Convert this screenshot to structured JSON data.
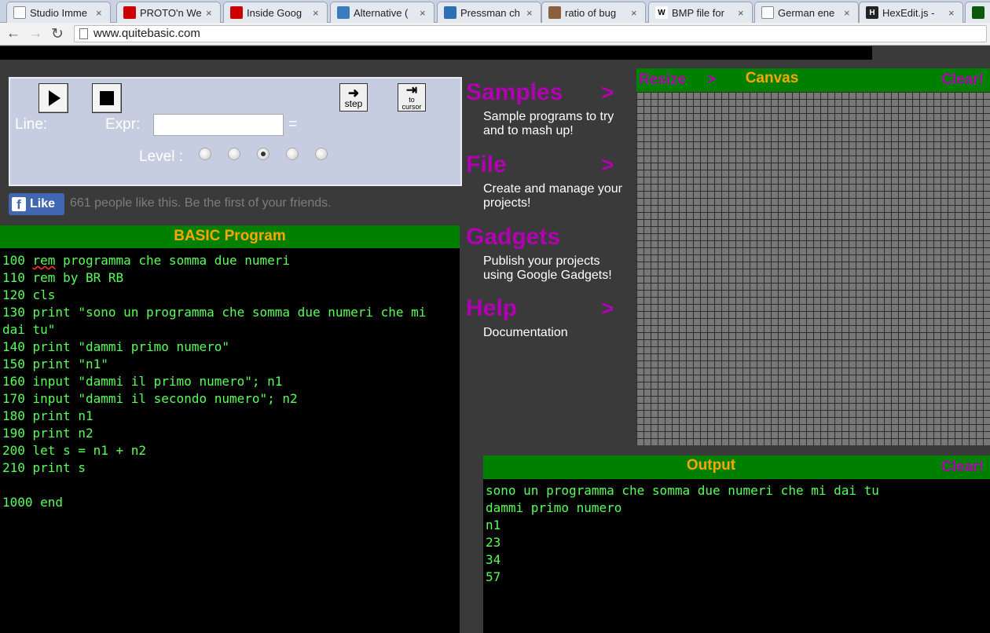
{
  "browser": {
    "tabs": [
      {
        "title": "Studio Imme",
        "icon": "page-icon",
        "icon_color": "#ffffff"
      },
      {
        "title": "PROTO'n We",
        "icon": "youtube-icon",
        "icon_color": "#cc0000"
      },
      {
        "title": "Inside Goog",
        "icon": "youtube-icon",
        "icon_color": "#cc0000"
      },
      {
        "title": "Alternative (",
        "icon": "stackexchange-icon",
        "icon_color": "#3a7dbd"
      },
      {
        "title": "Pressman ch",
        "icon": "robot-icon",
        "icon_color": "#2d6fb5"
      },
      {
        "title": "ratio of bug",
        "icon": "image-icon",
        "icon_color": "#8a6040"
      },
      {
        "title": "BMP file for",
        "icon": "wikipedia-icon",
        "icon_color": "#ffffff",
        "icon_text": "W"
      },
      {
        "title": "German ene",
        "icon": "page-icon",
        "icon_color": "#ffffff"
      },
      {
        "title": "HexEdit.js -",
        "icon": "hexedit-icon",
        "icon_color": "#222222",
        "icon_text": "H"
      },
      {
        "title": "",
        "icon": "terminal-icon",
        "icon_color": "#0a5a0a"
      }
    ],
    "url": "www.quitebasic.com"
  },
  "debugger": {
    "step_label": "step",
    "to_cursor_top": "to",
    "to_cursor_bottom": "cursor",
    "line_label": "Line:",
    "expr_label": "Expr:",
    "equals": "=",
    "level_label": "Level :",
    "expr_value": "",
    "levels": 5,
    "selected_level": 3
  },
  "like": {
    "button_label": "Like",
    "text": "661 people like this. Be the first of your friends."
  },
  "program": {
    "title": "BASIC Program",
    "lines": [
      {
        "prefix": "100 ",
        "spell": "rem",
        "rest": " programma che somma due numeri"
      },
      {
        "prefix": "110 rem by BR RB",
        "spell": "",
        "rest": ""
      },
      {
        "prefix": "120 cls",
        "spell": "",
        "rest": ""
      },
      {
        "prefix": "130 print \"sono un programma che somma due numeri che mi dai tu\"",
        "spell": "",
        "rest": ""
      },
      {
        "prefix": "140 print \"dammi primo numero\"",
        "spell": "",
        "rest": ""
      },
      {
        "prefix": "150 print \"n1\"",
        "spell": "",
        "rest": ""
      },
      {
        "prefix": "160 input \"dammi il primo numero\"; n1",
        "spell": "",
        "rest": ""
      },
      {
        "prefix": "170 input \"dammi il secondo numero\"; n2",
        "spell": "",
        "rest": ""
      },
      {
        "prefix": "180 print n1",
        "spell": "",
        "rest": ""
      },
      {
        "prefix": "190 print n2",
        "spell": "",
        "rest": ""
      },
      {
        "prefix": "200 let s = n1 + n2",
        "spell": "",
        "rest": ""
      },
      {
        "prefix": "210 print s",
        "spell": "",
        "rest": ""
      },
      {
        "prefix": "",
        "spell": "",
        "rest": ""
      },
      {
        "prefix": "1000 end",
        "spell": "",
        "rest": ""
      }
    ]
  },
  "menu": {
    "samples": {
      "title": "Samples",
      "arrow": ">",
      "desc": "Sample programs to try and to mash up!"
    },
    "file": {
      "title": "File",
      "arrow": ">",
      "desc": "Create and manage your projects!"
    },
    "gadgets": {
      "title": "Gadgets",
      "arrow": "",
      "desc": "Publish your projects using Google Gadgets!"
    },
    "help": {
      "title": "Help",
      "arrow": ">",
      "desc": "Documentation"
    }
  },
  "canvas": {
    "resize_label": "Resize",
    "resize_arrow": ">",
    "title": "Canvas",
    "clear_label": "Clear!"
  },
  "output": {
    "title": "Output",
    "clear_label": "Clear!",
    "lines": [
      "sono un programma che somma due numeri che mi dai tu",
      "dammi primo numero",
      "n1",
      "23",
      "34",
      "57"
    ]
  },
  "colors": {
    "header_green": "#008000",
    "header_orange": "#ffa500",
    "menu_purple": "#b000b0",
    "code_green": "#58ff58"
  }
}
